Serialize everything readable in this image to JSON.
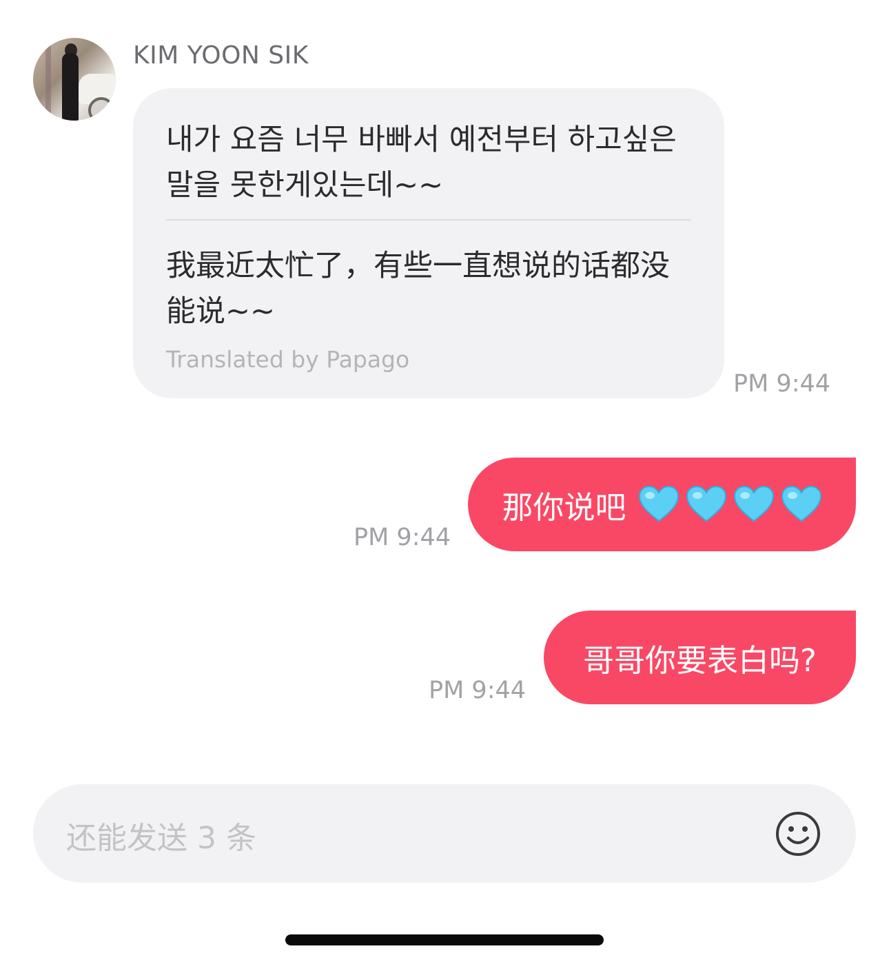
{
  "conversation": {
    "sender": {
      "name": "KIM YOON SIK"
    },
    "incoming": {
      "original_text": "내가 요즘 너무 바빠서 예전부터 하고싶은말을 못한게있는데~~",
      "translated_text": "我最近太忙了，有些一直想说的话都没能说~~",
      "translation_note": "Translated by Papago",
      "time": "PM 9:44"
    },
    "outgoing": [
      {
        "text": "那你说吧",
        "emoji": "blue-heart-icon x4",
        "time": "PM 9:44"
      },
      {
        "text": "哥哥你要表白吗?",
        "time": "PM 9:44"
      }
    ]
  },
  "composer": {
    "placeholder": "还能发送 3 条",
    "emoji_icon": "smiley-face-icon"
  },
  "colors": {
    "outgoing_bubble": "#f94865",
    "incoming_bubble": "#f2f2f4",
    "heart": "#5ccff5"
  }
}
